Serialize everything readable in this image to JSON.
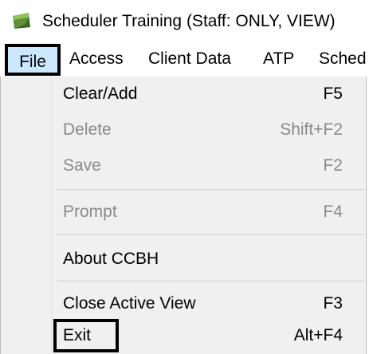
{
  "window": {
    "title": "Scheduler Training (Staff: ONLY, VIEW)",
    "icon": "scheduler-app-icon"
  },
  "menubar": {
    "items": [
      {
        "label": "File"
      },
      {
        "label": "Access"
      },
      {
        "label": "Client Data"
      },
      {
        "label": "ATP"
      },
      {
        "label": "Sched"
      }
    ]
  },
  "file_menu": {
    "items": [
      {
        "label": "Clear/Add",
        "shortcut": "F5",
        "enabled": true
      },
      {
        "label": "Delete",
        "shortcut": "Shift+F2",
        "enabled": false
      },
      {
        "label": "Save",
        "shortcut": "F2",
        "enabled": false
      },
      {
        "label": "Prompt",
        "shortcut": "F4",
        "enabled": false
      },
      {
        "label": "About CCBH",
        "shortcut": "",
        "enabled": true
      },
      {
        "label": "Close Active View",
        "shortcut": "F3",
        "enabled": true
      },
      {
        "label": "Exit",
        "shortcut": "Alt+F4",
        "enabled": true
      }
    ]
  },
  "colors": {
    "highlight_box": "#000000",
    "file_selected_bg": "#cce8ff",
    "menu_bg": "#f0f0f0",
    "disabled_text": "#8a8a8a"
  }
}
